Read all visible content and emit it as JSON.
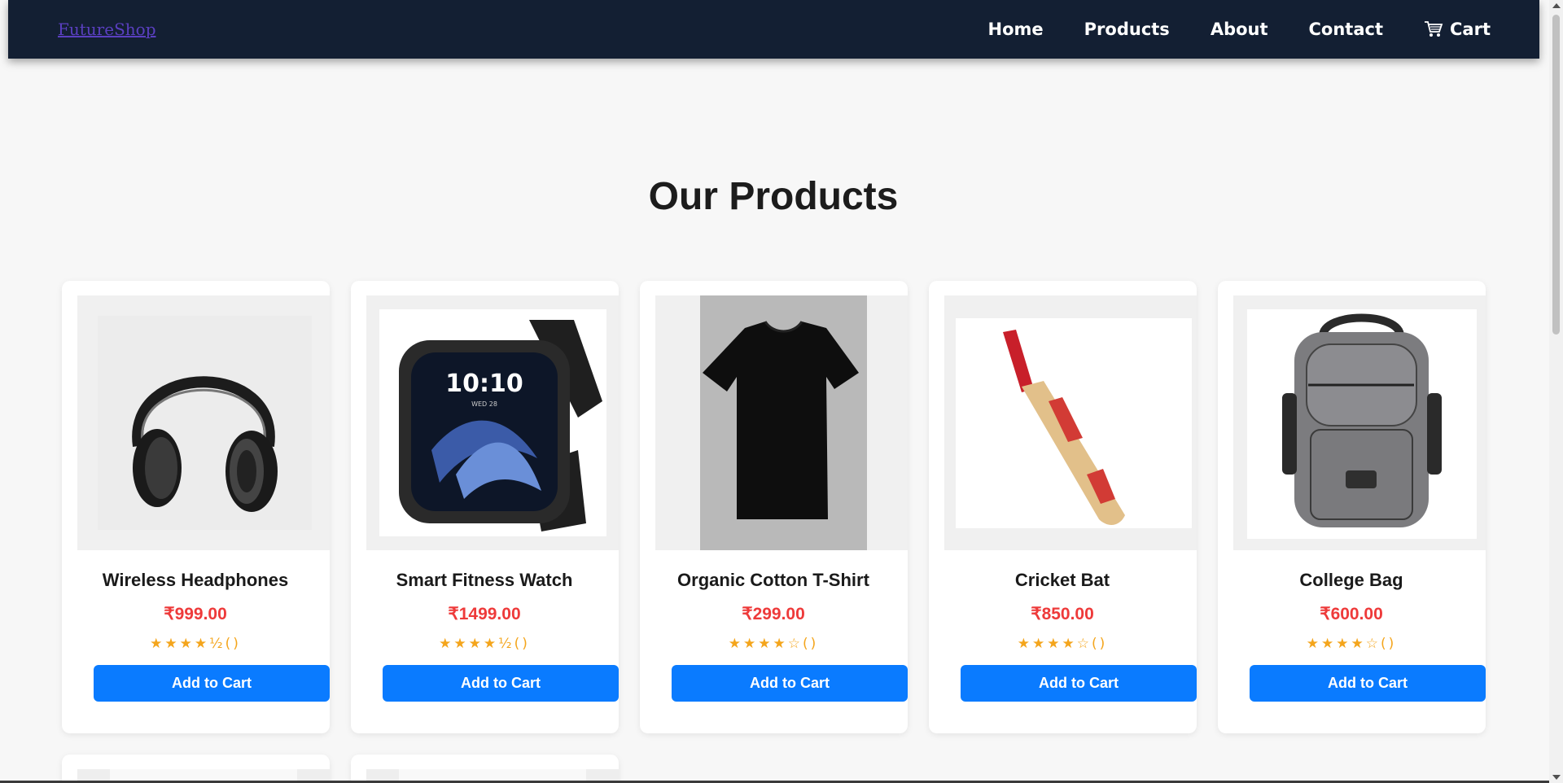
{
  "nav": {
    "brand": "FutureShop",
    "links": [
      "Home",
      "Products",
      "About",
      "Contact"
    ],
    "cart_label": "Cart",
    "cart_icon": "shopping-cart-icon"
  },
  "page_title": "Our Products",
  "products": [
    {
      "name": "Wireless Headphones",
      "price": "₹999.00",
      "rating": "★★★★½()",
      "stars": 4.5,
      "button": "Add to Cart",
      "image": "headphones"
    },
    {
      "name": "Smart Fitness Watch",
      "price": "₹1499.00",
      "rating": "★★★★½()",
      "stars": 4.5,
      "button": "Add to Cart",
      "image": "smartwatch"
    },
    {
      "name": "Organic Cotton T-Shirt",
      "price": "₹299.00",
      "rating": "★★★★☆()",
      "stars": 4,
      "button": "Add to Cart",
      "image": "t-shirt"
    },
    {
      "name": "Cricket Bat",
      "price": "₹850.00",
      "rating": "★★★★☆()",
      "stars": 4,
      "button": "Add to Cart",
      "image": "cricket-bat"
    },
    {
      "name": "College Bag",
      "price": "₹600.00",
      "rating": "★★★★☆()",
      "stars": 4,
      "button": "Add to Cart",
      "image": "backpack"
    }
  ],
  "colors": {
    "navbar": "#131f33",
    "price": "#ee3a3a",
    "button": "#0a7bff",
    "stars": "#f4a51c"
  },
  "watch_time": "10:10",
  "watch_date": "WED 28"
}
